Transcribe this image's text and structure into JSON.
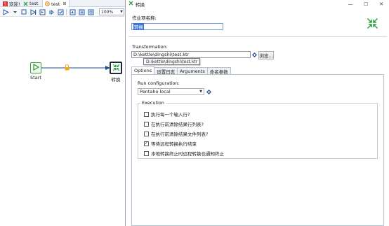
{
  "tabs": [
    {
      "label": "欢迎!",
      "icon": "welcome-icon"
    },
    {
      "label": "test",
      "icon": "job-icon"
    },
    {
      "label": "test",
      "icon": "transformation-icon",
      "close": "⊠"
    }
  ],
  "toolbar": {
    "zoom": "100%"
  },
  "canvas": {
    "start_label": "Start",
    "transform_label": "转换"
  },
  "dialog": {
    "title": "转换",
    "entry_name_label": "作业项名称:",
    "entry_name_value": "转换",
    "transformation_label": "Transformation:",
    "transformation_path": "D:\\kettle\\dingshi\\test.ktr",
    "browse_button": "浏览...",
    "tooltip": "D:\\kettle\\dingshi\\test.ktr",
    "tabs": [
      "Options",
      "设置日志",
      "Arguments",
      "命名参数"
    ],
    "run_config_label": "Run configuration:",
    "run_config_value": "Pentaho local",
    "execution_title": "Execution",
    "checkboxes": [
      {
        "label": "执行每一个输入行?",
        "checked": false,
        "mark": ""
      },
      {
        "label": "在执行前清除结果行列表?",
        "checked": false,
        "mark": ""
      },
      {
        "label": "在执行前清除结果文件列表?",
        "checked": false,
        "mark": ""
      },
      {
        "label": "等待远程转换执行结束",
        "checked": true,
        "mark": "✓"
      },
      {
        "label": "本地转换终止时远程转换也通知终止",
        "checked": false,
        "mark": ""
      }
    ]
  },
  "colors": {
    "accent": "#3875d7",
    "start_green": "#3aa335",
    "hop_blue": "#1f4e8c",
    "lock_orange": "#f5a623"
  }
}
